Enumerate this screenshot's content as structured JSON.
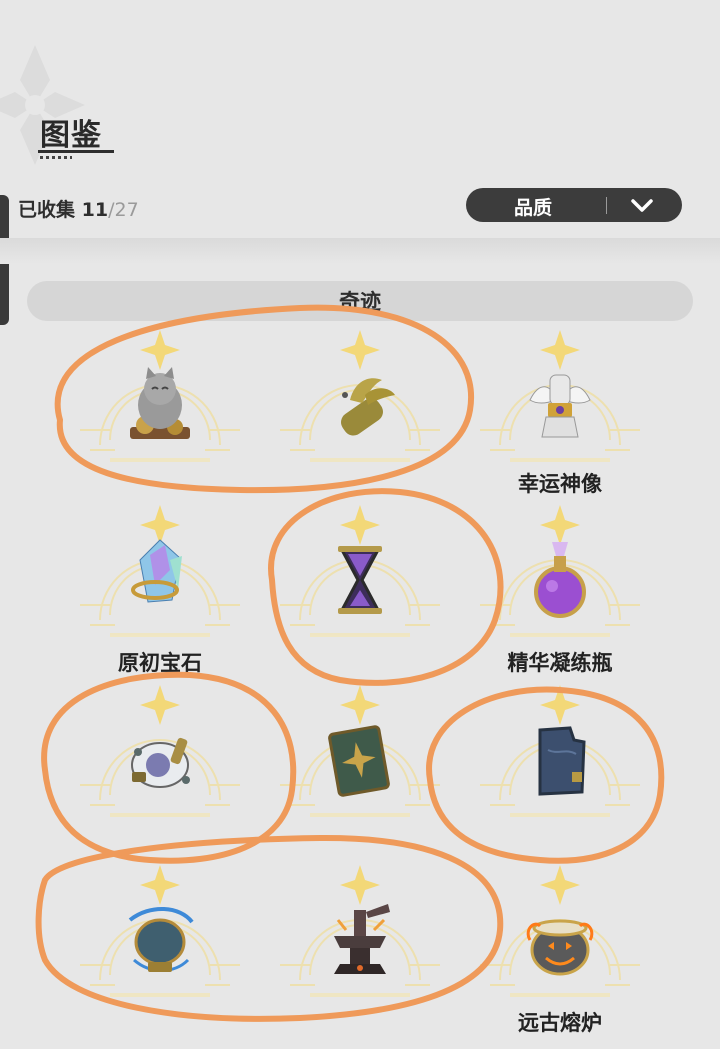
{
  "header": {
    "title": "图鉴",
    "collected_label": "已收集",
    "collected_count": "11",
    "collected_total": "/27"
  },
  "filter": {
    "label": "品质",
    "icon": "chevron-down-icon"
  },
  "section": {
    "title": "奇迹"
  },
  "items": [
    {
      "name": "",
      "icon": "lucky-cat-icon",
      "circled": true
    },
    {
      "name": "",
      "icon": "golden-branch-icon",
      "circled": true
    },
    {
      "name": "幸运神像",
      "icon": "winged-statue-icon",
      "circled": false
    },
    {
      "name": "原初宝石",
      "icon": "crystal-gem-icon",
      "circled": false
    },
    {
      "name": "",
      "icon": "hourglass-icon",
      "circled": true
    },
    {
      "name": "精华凝练瓶",
      "icon": "essence-flask-icon",
      "circled": false
    },
    {
      "name": "",
      "icon": "orb-relic-icon",
      "circled": true
    },
    {
      "name": "",
      "icon": "ancient-book-icon",
      "circled": false
    },
    {
      "name": "",
      "icon": "stone-tablet-icon",
      "circled": true
    },
    {
      "name": "",
      "icon": "storm-urn-icon",
      "circled": true
    },
    {
      "name": "",
      "icon": "anvil-icon",
      "circled": true
    },
    {
      "name": "远古熔炉",
      "icon": "pumpkin-cauldron-icon",
      "circled": false
    }
  ],
  "colors": {
    "background": "#e7e7e7",
    "annotation_stroke": "#ef9a5a",
    "star_gold": "#f3d878"
  }
}
